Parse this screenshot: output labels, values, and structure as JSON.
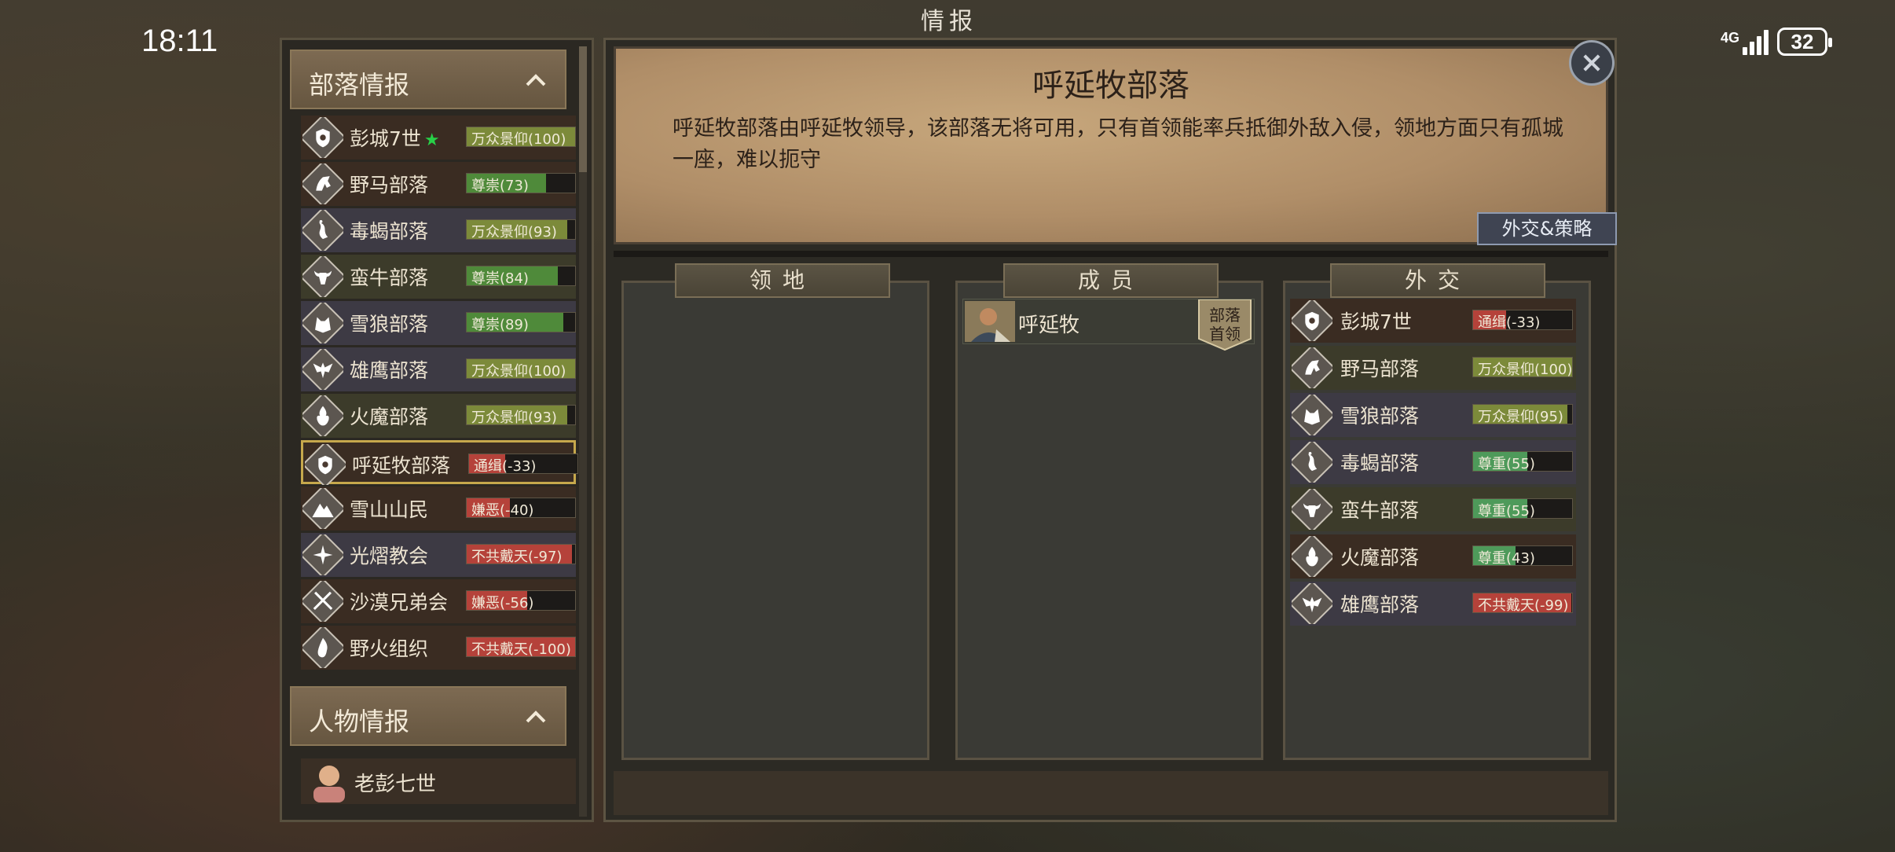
{
  "status_bar": {
    "time": "18:11",
    "network": "4G",
    "battery": "32"
  },
  "screen_title": "情报",
  "left_panel": {
    "tribes_header": "部落情报",
    "tribes": [
      {
        "name": "彭城7世",
        "star": "★",
        "relation": "万众景仰(100)",
        "value": 100,
        "color": "#7c8a3a",
        "icon": "shield-crest-icon"
      },
      {
        "name": "野马部落",
        "relation": "尊崇(73)",
        "value": 73,
        "color": "#4f8a3a",
        "icon": "horse-head-icon"
      },
      {
        "name": "毒蝎部落",
        "relation": "万众景仰(93)",
        "value": 93,
        "color": "#7c8a3a",
        "icon": "scorpion-icon"
      },
      {
        "name": "蛮牛部落",
        "relation": "尊崇(84)",
        "value": 84,
        "color": "#4f8a3a",
        "icon": "bull-head-icon"
      },
      {
        "name": "雪狼部落",
        "relation": "尊崇(89)",
        "value": 89,
        "color": "#4f8a3a",
        "icon": "wolf-head-icon"
      },
      {
        "name": "雄鹰部落",
        "relation": "万众景仰(100)",
        "value": 100,
        "color": "#7c8a3a",
        "icon": "eagle-icon"
      },
      {
        "name": "火魔部落",
        "relation": "万众景仰(93)",
        "value": 93,
        "color": "#7c8a3a",
        "icon": "flame-demon-icon"
      },
      {
        "name": "呼延牧部落",
        "relation": "通缉(-33)",
        "value": 33,
        "color": "#b5423a",
        "icon": "shield-crest-icon"
      },
      {
        "name": "雪山山民",
        "relation": "嫌恶(-40)",
        "value": 40,
        "color": "#b5423a",
        "icon": "mountain-icon"
      },
      {
        "name": "光熠教会",
        "relation": "不共戴天(-97)",
        "value": 97,
        "color": "#b5423a",
        "icon": "sun-cross-icon"
      },
      {
        "name": "沙漠兄弟会",
        "relation": "嫌恶(-56)",
        "value": 56,
        "color": "#b5423a",
        "icon": "crossed-swords-icon"
      },
      {
        "name": "野火组织",
        "relation": "不共戴天(-100)",
        "value": 100,
        "color": "#b5423a",
        "icon": "fire-icon"
      }
    ],
    "characters_header": "人物情报",
    "characters": [
      {
        "name": "老彭七世"
      }
    ]
  },
  "detail": {
    "title": "呼延牧部落",
    "description": "呼延牧部落由呼延牧领导，该部落无将可用，只有首领能率兵抵御外敌入侵，领地方面只有孤城一座，难以扼守",
    "diplomacy_button": "外交&策略",
    "columns": {
      "territory": "领地",
      "members": "成员",
      "diplomacy": "外交"
    },
    "members": [
      {
        "name": "呼延牧",
        "rank_line1": "部落",
        "rank_line2": "首领"
      }
    ],
    "relations": [
      {
        "name": "彭城7世",
        "relation": "通缉(-33)",
        "value": 33,
        "color": "#b5423a",
        "icon": "shield-crest-icon"
      },
      {
        "name": "野马部落",
        "relation": "万众景仰(100)",
        "value": 100,
        "color": "#7c8a3a",
        "icon": "horse-head-icon"
      },
      {
        "name": "雪狼部落",
        "relation": "万众景仰(95)",
        "value": 95,
        "color": "#7c8a3a",
        "icon": "wolf-head-icon"
      },
      {
        "name": "毒蝎部落",
        "relation": "尊重(55)",
        "value": 55,
        "color": "#4e9a5a",
        "icon": "scorpion-icon"
      },
      {
        "name": "蛮牛部落",
        "relation": "尊重(55)",
        "value": 55,
        "color": "#4e9a5a",
        "icon": "bull-head-icon"
      },
      {
        "name": "火魔部落",
        "relation": "尊重(43)",
        "value": 43,
        "color": "#4e9a5a",
        "icon": "flame-demon-icon"
      },
      {
        "name": "雄鹰部落",
        "relation": "不共戴天(-99)",
        "value": 99,
        "color": "#b5423a",
        "icon": "eagle-icon"
      }
    ]
  }
}
